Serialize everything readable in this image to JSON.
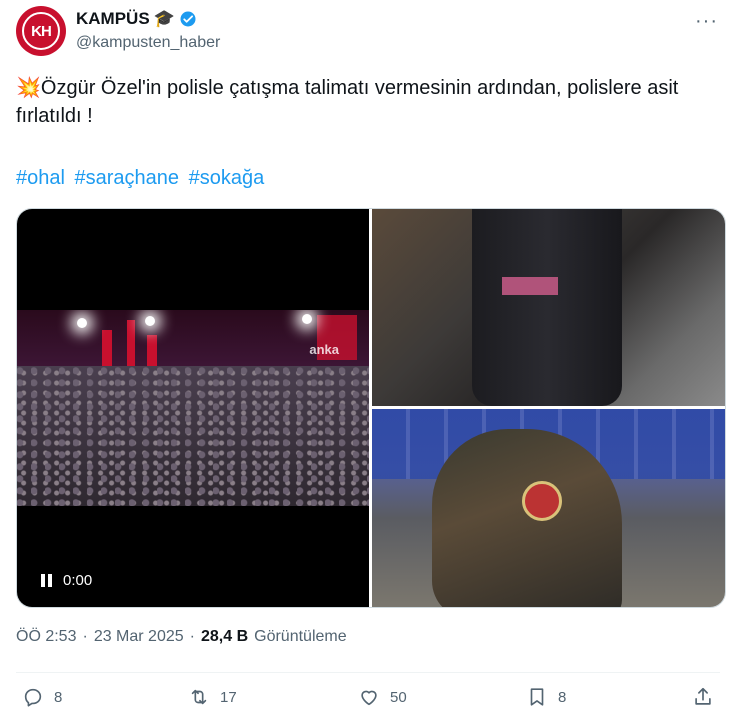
{
  "author": {
    "display_name": "KAMPÜS",
    "handle": "@kampusten_haber",
    "avatar_initials": "KH"
  },
  "tweet": {
    "text": "Özgür Özel'in polisle çatışma talimatı vermesinin ardından, polislere asit fırlatıldı !",
    "emoji_icon": "collision-emoji",
    "hashtags": [
      "#ohal",
      "#saraçhane",
      "#sokağa"
    ]
  },
  "media": {
    "video_time": "0:00",
    "video_watermark": "anka"
  },
  "meta": {
    "time": "ÖÖ 2:53",
    "separator": "·",
    "date": "23 Mar 2025",
    "views_count": "28,4 B",
    "views_label": "Görüntüleme"
  },
  "actions": {
    "replies": "8",
    "reposts": "17",
    "likes": "50",
    "bookmarks": "8"
  },
  "colors": {
    "accent": "#1d9bf0",
    "verified": "#1d9bf0",
    "muted": "#536471"
  }
}
